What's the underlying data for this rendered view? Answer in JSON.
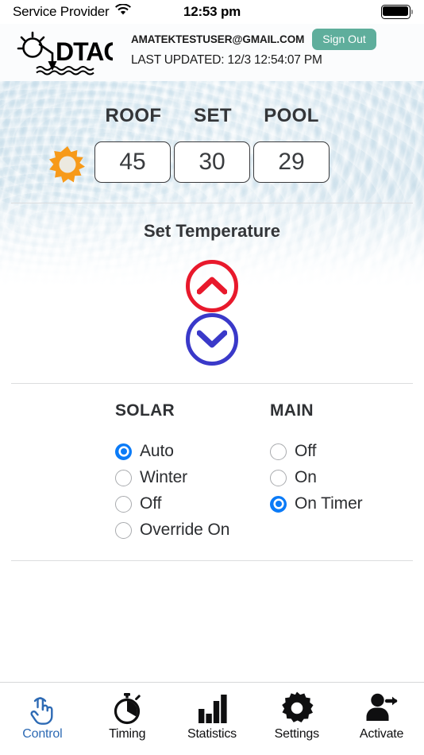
{
  "statusbar": {
    "carrier": "Service Provider",
    "wifi_icon": "wifi-icon",
    "time": "12:53 pm",
    "battery_icon": "battery-full-icon"
  },
  "header": {
    "logo_text": "DTAC",
    "logo_icon": "dtac-sun-water-logo",
    "email": "AMATEKTESTUSER@GMAIL.COM",
    "sign_out_label": "Sign Out",
    "last_updated": "LAST UPDATED: 12/3 12:54:07 PM",
    "sign_out_color": "#5fae9c"
  },
  "temperatures": {
    "sun_icon": "sun-icon",
    "sun_color": "#f79a1a",
    "items": [
      {
        "label": "ROOF",
        "value": "45"
      },
      {
        "label": "SET",
        "value": "30"
      },
      {
        "label": "POOL",
        "value": "29"
      }
    ]
  },
  "set_temperature": {
    "title": "Set Temperature",
    "up_icon": "chevron-up-icon",
    "down_icon": "chevron-down-icon",
    "up_color": "#e8192c",
    "down_color": "#3a39c9"
  },
  "solar": {
    "title": "SOLAR",
    "options": [
      {
        "label": "Auto",
        "selected": true
      },
      {
        "label": "Winter",
        "selected": false
      },
      {
        "label": "Off",
        "selected": false
      },
      {
        "label": "Override On",
        "selected": false
      }
    ]
  },
  "main_mode": {
    "title": "MAIN",
    "options": [
      {
        "label": "Off",
        "selected": false
      },
      {
        "label": "On",
        "selected": false
      },
      {
        "label": "On Timer",
        "selected": true
      }
    ]
  },
  "tabbar": {
    "active_color": "#2d6ab4",
    "tabs": [
      {
        "label": "Control",
        "icon": "tap-hand-icon",
        "active": true
      },
      {
        "label": "Timing",
        "icon": "stopwatch-icon",
        "active": false
      },
      {
        "label": "Statistics",
        "icon": "bar-chart-icon",
        "active": false
      },
      {
        "label": "Settings",
        "icon": "gear-icon",
        "active": false
      },
      {
        "label": "Activate",
        "icon": "user-arrow-icon",
        "active": false
      }
    ]
  }
}
